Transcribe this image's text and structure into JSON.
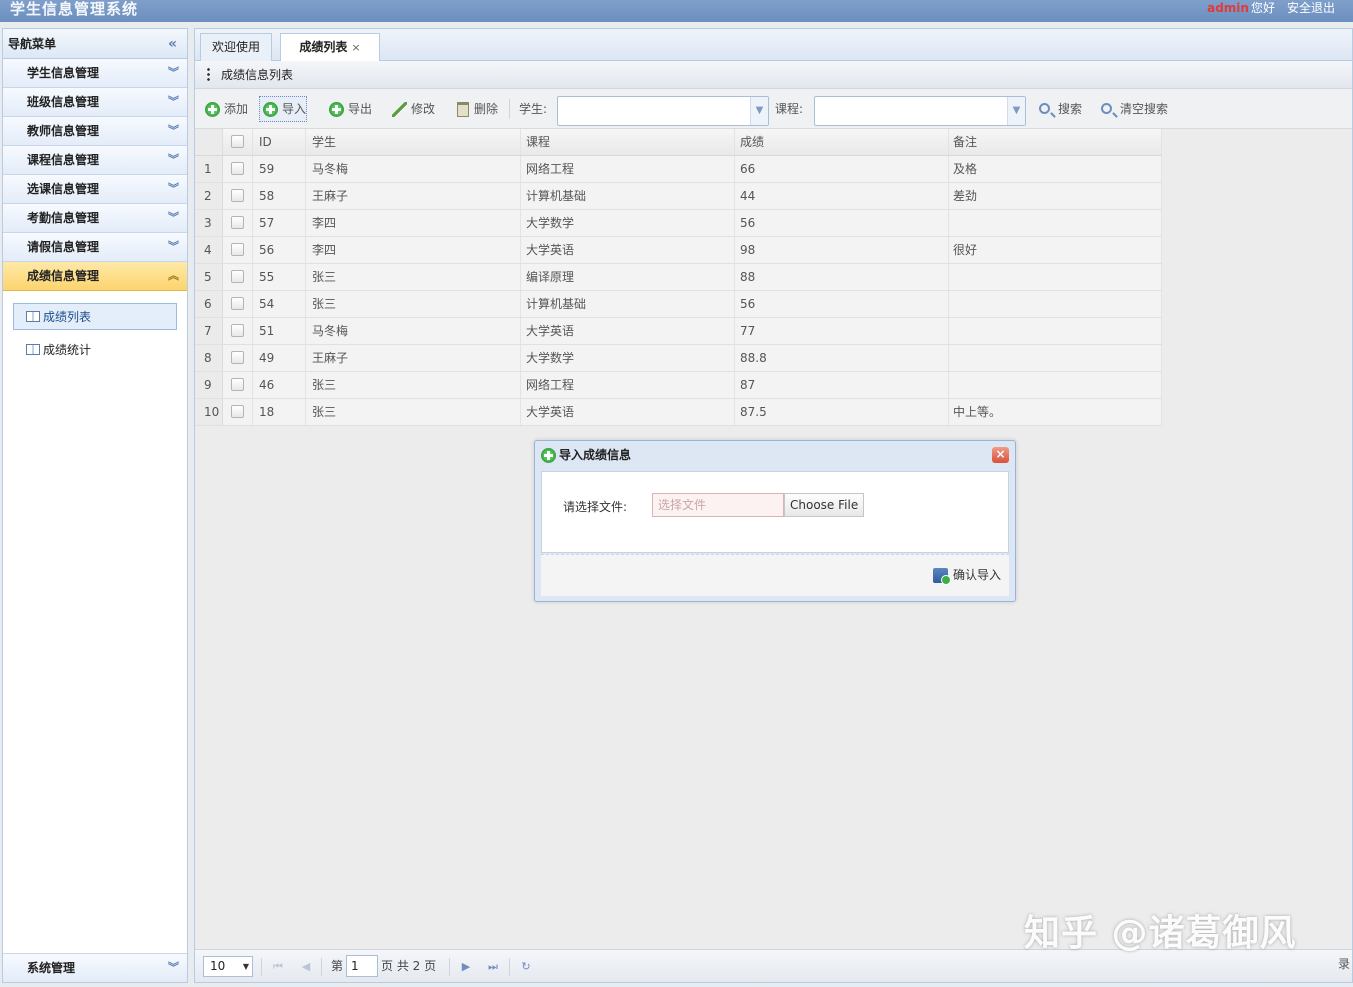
{
  "header": {
    "title": "学生信息管理系统",
    "user": "admin",
    "greeting": "您好",
    "logout": "安全退出"
  },
  "sidebar": {
    "title": "导航菜单",
    "collapse_icon": "«",
    "items": [
      {
        "label": "学生信息管理",
        "arrow": "︾"
      },
      {
        "label": "班级信息管理",
        "arrow": "︾"
      },
      {
        "label": "教师信息管理",
        "arrow": "︾"
      },
      {
        "label": "课程信息管理",
        "arrow": "︾"
      },
      {
        "label": "选课信息管理",
        "arrow": "︾"
      },
      {
        "label": "考勤信息管理",
        "arrow": "︾"
      },
      {
        "label": "请假信息管理",
        "arrow": "︾"
      },
      {
        "label": "成绩信息管理",
        "arrow": "︽"
      }
    ],
    "sub_items": [
      {
        "label": "成绩列表"
      },
      {
        "label": "成绩统计"
      }
    ],
    "system": {
      "label": "系统管理",
      "arrow": "︾"
    }
  },
  "tabs": [
    {
      "label": "欢迎使用"
    },
    {
      "label": "成绩列表",
      "close": "×"
    }
  ],
  "panel": {
    "title": "成绩信息列表"
  },
  "toolbar": {
    "add": "添加",
    "import": "导入",
    "export": "导出",
    "edit": "修改",
    "delete": "删除",
    "student_label": "学生:",
    "course_label": "课程:",
    "search": "搜索",
    "clear_search": "清空搜索"
  },
  "grid": {
    "headers": {
      "id": "ID",
      "student": "学生",
      "course": "课程",
      "score": "成绩",
      "remark": "备注"
    },
    "rows": [
      {
        "n": "1",
        "id": "59",
        "student": "马冬梅",
        "course": "网络工程",
        "score": "66",
        "remark": "及格"
      },
      {
        "n": "2",
        "id": "58",
        "student": "王麻子",
        "course": "计算机基础",
        "score": "44",
        "remark": "差劲"
      },
      {
        "n": "3",
        "id": "57",
        "student": "李四",
        "course": "大学数学",
        "score": "56",
        "remark": ""
      },
      {
        "n": "4",
        "id": "56",
        "student": "李四",
        "course": "大学英语",
        "score": "98",
        "remark": "很好"
      },
      {
        "n": "5",
        "id": "55",
        "student": "张三",
        "course": "编译原理",
        "score": "88",
        "remark": ""
      },
      {
        "n": "6",
        "id": "54",
        "student": "张三",
        "course": "计算机基础",
        "score": "56",
        "remark": ""
      },
      {
        "n": "7",
        "id": "51",
        "student": "马冬梅",
        "course": "大学英语",
        "score": "77",
        "remark": ""
      },
      {
        "n": "8",
        "id": "49",
        "student": "王麻子",
        "course": "大学数学",
        "score": "88.8",
        "remark": ""
      },
      {
        "n": "9",
        "id": "46",
        "student": "张三",
        "course": "网络工程",
        "score": "87",
        "remark": ""
      },
      {
        "n": "10",
        "id": "18",
        "student": "张三",
        "course": "大学英语",
        "score": "87.5",
        "remark": "中上等。"
      }
    ]
  },
  "pager": {
    "page_size": "10",
    "first": "⏮",
    "prev": "◀",
    "page_prefix": "第",
    "page": "1",
    "page_suffix": "页 共 2 页",
    "next": "▶",
    "last": "⏭",
    "refresh": "↻"
  },
  "dialog": {
    "title": "导入成绩信息",
    "close": "×",
    "file_label": "请选择文件:",
    "file_placeholder": "选择文件",
    "choose_button": "Choose File",
    "confirm": "确认导入"
  },
  "watermark": "知乎 @诸葛御风",
  "edge_text": "录"
}
